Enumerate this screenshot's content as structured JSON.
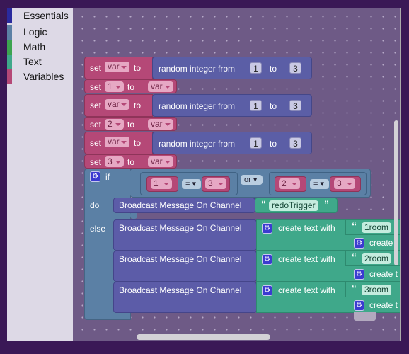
{
  "toolbox": {
    "categories": [
      {
        "label": "Essentials",
        "color": "#2a2a9e"
      },
      {
        "label": "Logic",
        "color": "#5b80a5"
      },
      {
        "label": "Math",
        "color": "#3ca450"
      },
      {
        "label": "Text",
        "color": "#3fa88a"
      },
      {
        "label": "Variables",
        "color": "#b54877"
      }
    ]
  },
  "blocks": {
    "set": "set",
    "to": "to",
    "var": "var",
    "random": "random integer from",
    "from": "1",
    "upto": "3",
    "set_targets": [
      "1",
      "2",
      "3"
    ],
    "if": "if",
    "do": "do",
    "else": "else",
    "or": "or",
    "eq": "=",
    "cond1": {
      "a": "1",
      "b": "3"
    },
    "cond2": {
      "a": "2",
      "b": "3"
    },
    "broadcast": "Broadcast Message On Channel",
    "redo": "redoTrigger",
    "create_text": "create text with",
    "create_clipped": "create",
    "create_clipped2": "create t",
    "rooms": [
      "1room",
      "2room",
      "3room"
    ],
    "open_quote": "“",
    "close_quote": "”"
  }
}
